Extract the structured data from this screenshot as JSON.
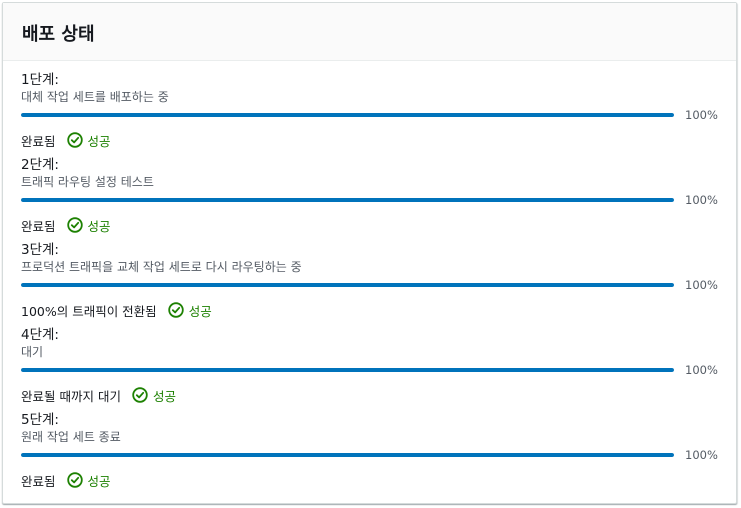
{
  "panel": {
    "title": "배포 상태"
  },
  "colors": {
    "progress": "#0073bb",
    "success": "#1d8102"
  },
  "steps": [
    {
      "title": "1단계:",
      "description": "대체 작업 세트를 배포하는 중",
      "progress": 1.0,
      "progress_label": "100%",
      "status": "완료됨",
      "result": "성공"
    },
    {
      "title": "2단계:",
      "description": "트래픽 라우팅 설정 테스트",
      "progress": 1.0,
      "progress_label": "100%",
      "status": "완료됨",
      "result": "성공"
    },
    {
      "title": "3단계:",
      "description": "프로덕션 트래픽을 교체 작업 세트로 다시 라우팅하는 중",
      "progress": 1.0,
      "progress_label": "100%",
      "status": "100%의 트래픽이 전환됨",
      "result": "성공"
    },
    {
      "title": "4단계:",
      "description": "대기",
      "progress": 1.0,
      "progress_label": "100%",
      "status": "완료될 때까지 대기",
      "result": "성공"
    },
    {
      "title": "5단계:",
      "description": "원래 작업 세트 종료",
      "progress": 1.0,
      "progress_label": "100%",
      "status": "완료됨",
      "result": "성공"
    }
  ]
}
